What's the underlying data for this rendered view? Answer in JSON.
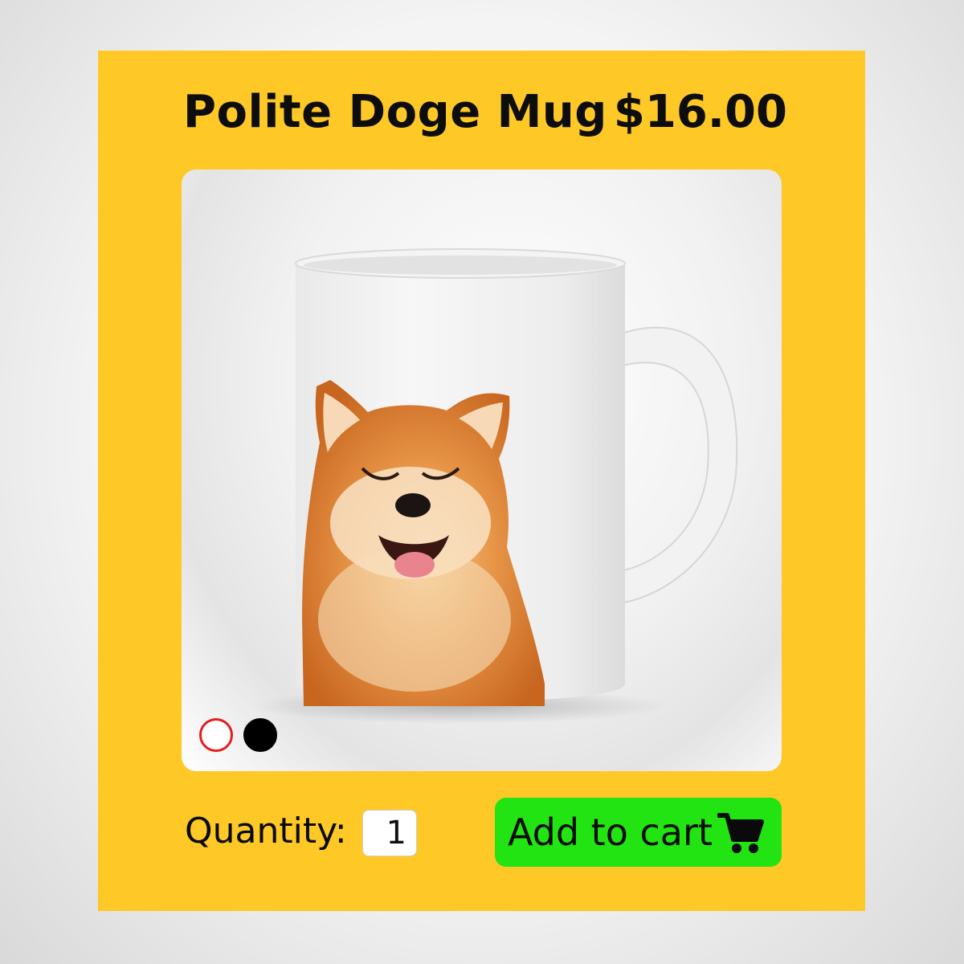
{
  "product": {
    "title": "Polite Doge Mug",
    "price": "$16.00"
  },
  "image": {
    "subject": "white mug with smiling shiba inu print",
    "icon": "product-photo"
  },
  "color_options": [
    {
      "name": "white",
      "color": "#ffffff",
      "selected": true,
      "ring_color": "#e41e1e"
    },
    {
      "name": "black",
      "color": "#000000",
      "selected": false
    }
  ],
  "quantity": {
    "label": "Quantity:",
    "value": "1"
  },
  "cart_button": {
    "label": "Add to cart",
    "icon": "shopping-cart-icon"
  },
  "colors": {
    "card_background": "#fec827",
    "button_background": "#22e412",
    "text": "#0d0d0d"
  }
}
